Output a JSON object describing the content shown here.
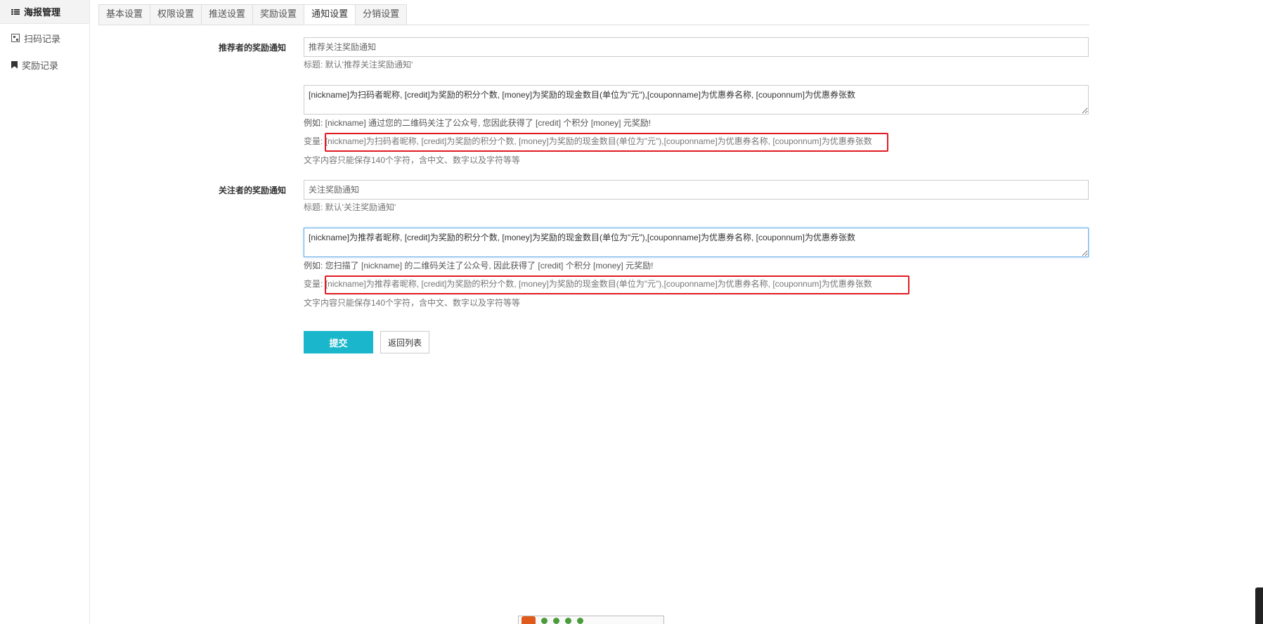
{
  "sidebar": {
    "items": [
      {
        "label": "海报管理",
        "icon": "list-icon"
      },
      {
        "label": "扫码记录",
        "icon": "qrcode-icon"
      },
      {
        "label": "奖励记录",
        "icon": "bookmark-icon"
      }
    ]
  },
  "tabs": [
    "基本设置",
    "权限设置",
    "推送设置",
    "奖励设置",
    "通知设置",
    "分销设置"
  ],
  "active_tab": "通知设置",
  "referrer": {
    "label": "推荐者的奖励通知",
    "title_placeholder": "推荐关注奖励通知",
    "title_help": "标题: 默认'推荐关注奖励通知'",
    "content_value": "[nickname]为扫码者昵称, [credit]为奖励的积分个数, [money]为奖励的现金数目(单位为\"元\"),[couponname]为优惠券名称, [couponnum]为优惠券张数",
    "example": "例如: [nickname] 通过您的二维码关注了公众号, 您因此获得了 [credit] 个积分 [money] 元奖励!",
    "var_prefix": "变量:",
    "variables": "[nickname]为扫码者昵称, [credit]为奖励的积分个数, [money]为奖励的现金数目(单位为\"元\"),[couponname]为优惠券名称, [couponnum]为优惠券张数",
    "limit_note": "文字内容只能保存140个字符，含中文、数字以及字符等等"
  },
  "follower": {
    "label": "关注者的奖励通知",
    "title_placeholder": "关注奖励通知",
    "title_help": "标题: 默认'关注奖励通知'",
    "content_value": "[nickname]为推荐者昵称, [credit]为奖励的积分个数, [money]为奖励的现金数目(单位为\"元\"),[couponname]为优惠券名称, [couponnum]为优惠券张数",
    "example": "例如: 您扫描了 [nickname] 的二维码关注了公众号, 因此获得了 [credit] 个积分 [money] 元奖励!",
    "var_prefix": "变量:",
    "variables": "[nickname]为推荐者昵称, [credit]为奖励的积分个数, [money]为奖励的现金数目(单位为\"元\"),[couponname]为优惠券名称, [couponnum]为优惠券张数",
    "limit_note": "文字内容只能保存140个字符，含中文、数字以及字符等等"
  },
  "buttons": {
    "submit": "提交",
    "back": "返回列表"
  },
  "colors": {
    "primary": "#1ab7cc",
    "highlight": "#e11b22",
    "focus": "#66afe9"
  }
}
